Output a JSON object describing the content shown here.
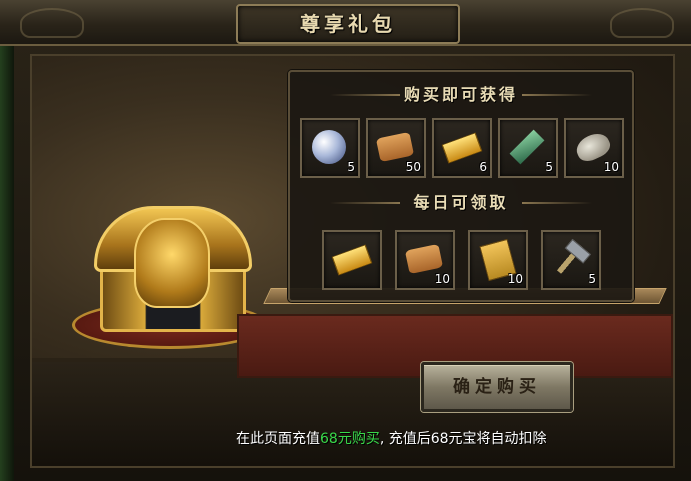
{
  "window": {
    "title": "尊享礼包"
  },
  "panel": {
    "purchase_header": "购买即可获得",
    "purchase_items": [
      {
        "icon": "crystal-orb-icon",
        "qty": "5"
      },
      {
        "icon": "scroll-icon",
        "qty": "50"
      },
      {
        "icon": "gold-ingot-icon",
        "qty": "6"
      },
      {
        "icon": "jade-gem-icon",
        "qty": "5"
      },
      {
        "icon": "silver-pouch-icon",
        "qty": "10"
      }
    ],
    "daily_header": "每日可领取",
    "daily_items": [
      {
        "icon": "gold-ingot-icon",
        "qty": ""
      },
      {
        "icon": "scroll-icon",
        "qty": "10"
      },
      {
        "icon": "golden-ticket-icon",
        "qty": "10"
      },
      {
        "icon": "hammer-icon",
        "qty": "5"
      }
    ]
  },
  "confirm_button": {
    "label": "确定购买"
  },
  "note": {
    "prefix": "在此页面充值",
    "highlight": "68元购买",
    "suffix": ", 充值后68元宝将自动扣除"
  },
  "colors": {
    "highlight": "#39d84a",
    "title": "#e8d9b0"
  }
}
